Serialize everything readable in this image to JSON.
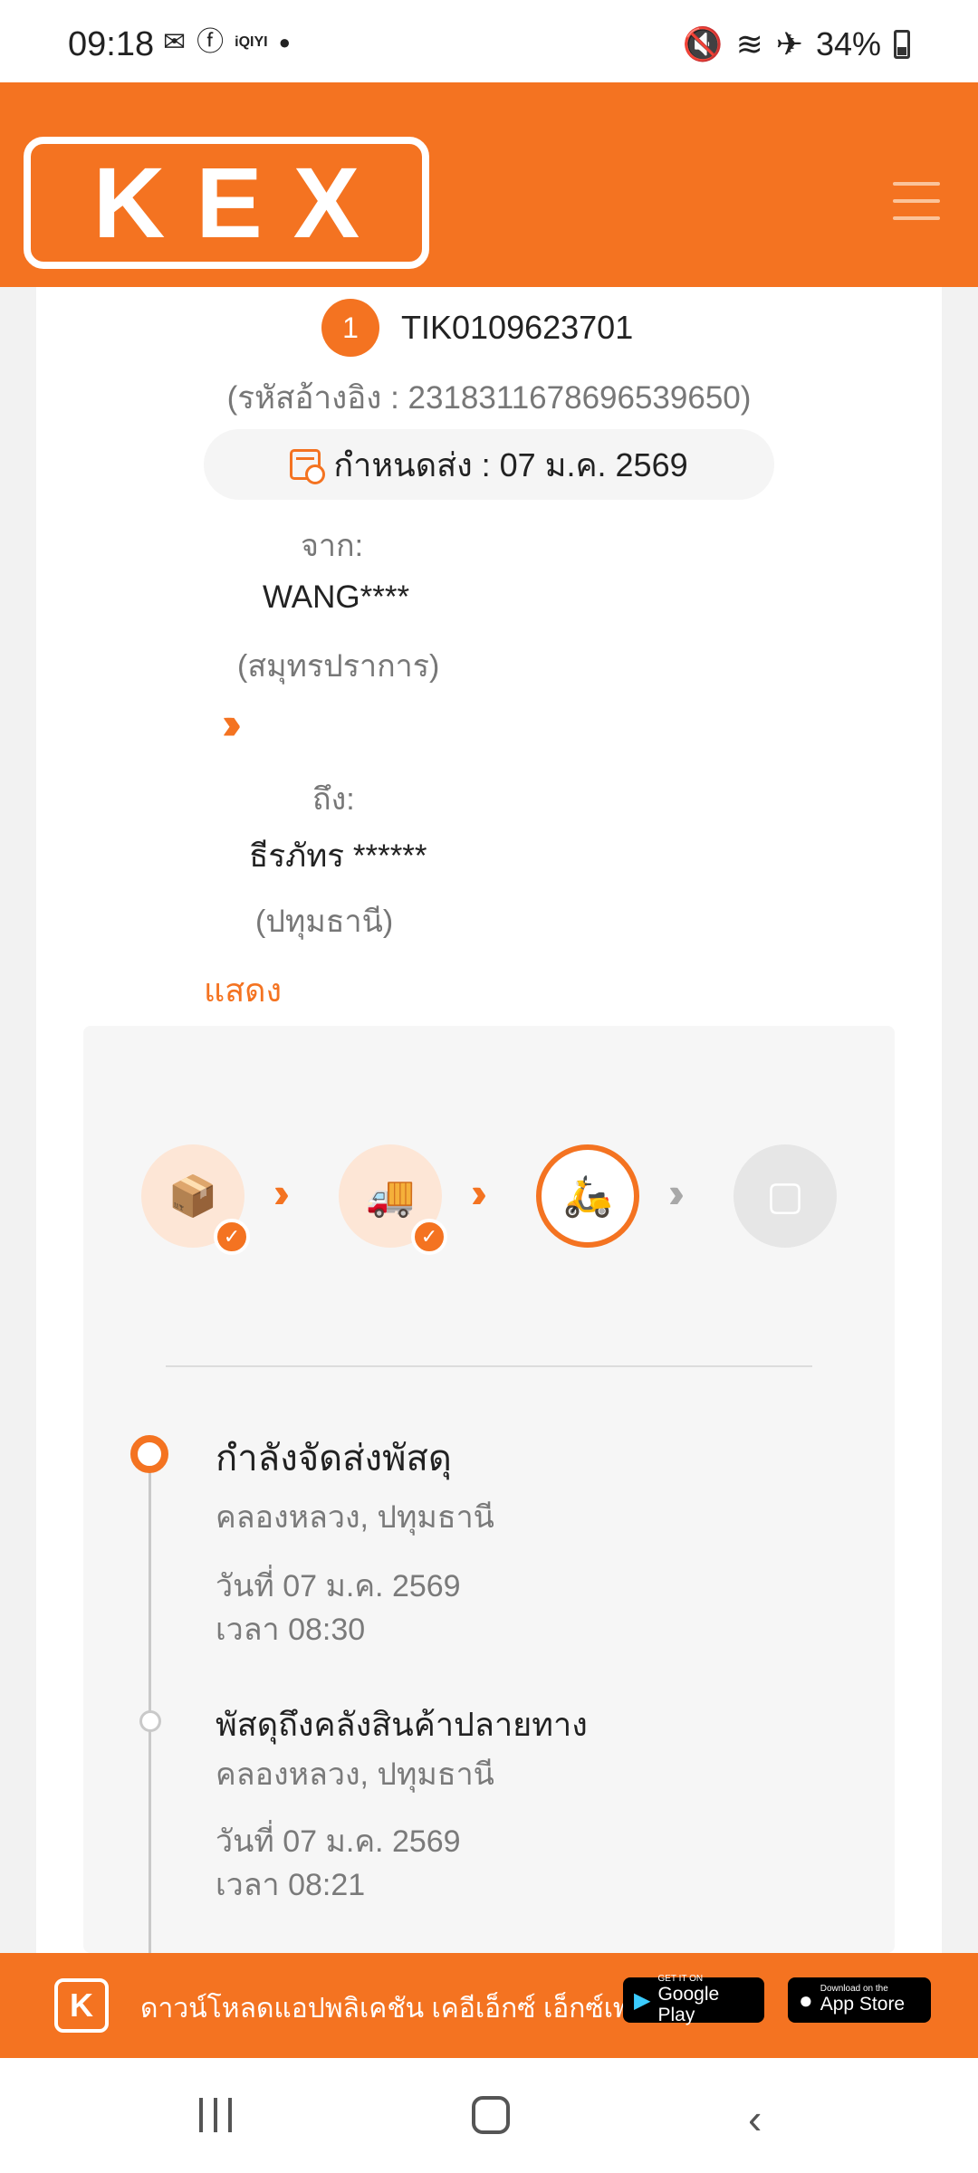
{
  "status_bar": {
    "time": "09:18",
    "left_icons": [
      "gmail-icon",
      "facebook-icon",
      "iqiyi-icon",
      "dot-icon"
    ],
    "iqiyi_label": "iQIYI",
    "battery": "34%"
  },
  "header": {
    "logo_text": "KEX"
  },
  "parcel": {
    "index": "1",
    "tracking_number": "TIK0109623701",
    "reference": "(รหัสอ้างอิง : 2318311678696539650)",
    "due_date": "กำหนดส่ง : 07 ม.ค. 2569",
    "from_label": "จาก:",
    "sender_name": "WANG****",
    "sender_province": "(สมุทรปราการ)",
    "to_label": "ถึง:",
    "recipient_name": "ธีรภัทร ******",
    "recipient_province": "(ปทุมธานี)",
    "show_link": "แสดง"
  },
  "progress_steps": [
    {
      "name": "picked-up",
      "state": "done",
      "icon": "parcel-icon"
    },
    {
      "name": "in-transit",
      "state": "done",
      "icon": "truck-icon"
    },
    {
      "name": "out-for-delivery",
      "state": "active",
      "icon": "scooter-icon"
    },
    {
      "name": "delivered",
      "state": "pending",
      "icon": "box-icon"
    }
  ],
  "timeline": [
    {
      "title": "กำลังจัดส่งพัสดุ",
      "location": "คลองหลวง, ปทุมธานี",
      "date": "วันที่ 07 ม.ค. 2569",
      "time": "เวลา 08:30"
    },
    {
      "title": "พัสดุถึงคลังสินค้าปลายทาง",
      "location": "คลองหลวง, ปทุมธานี",
      "date": "วันที่ 07 ม.ค. 2569",
      "time": "เวลา 08:21"
    }
  ],
  "banner": {
    "logo_letter": "K",
    "text": "ดาวน์โหลดแอปพลิเคชัน เคอีเอ็กซ์ เอ็กซ์เพรส",
    "google_small": "GET IT ON",
    "google_big": "Google Play",
    "apple_small": "Download on the",
    "apple_big": "App Store"
  },
  "colors": {
    "brand_orange": "#f47321",
    "text_dark": "#222222",
    "text_muted": "#777777"
  }
}
